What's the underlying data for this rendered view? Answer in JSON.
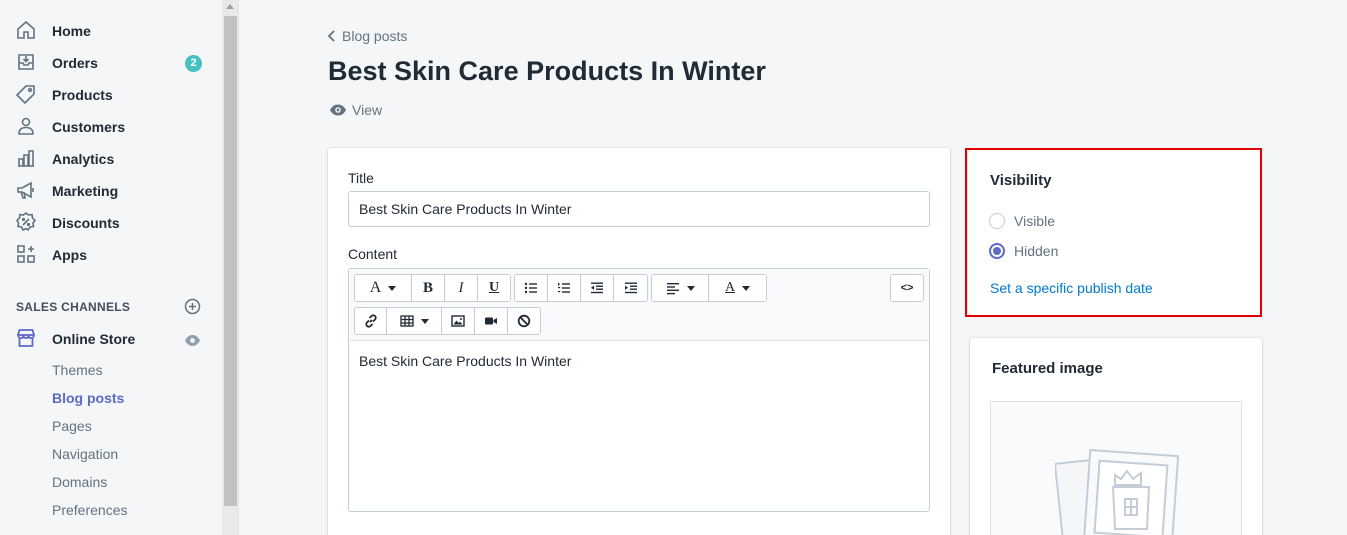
{
  "sidebar": {
    "items": [
      {
        "label": "Home",
        "icon": "home-icon"
      },
      {
        "label": "Orders",
        "icon": "orders-icon",
        "badge": "2"
      },
      {
        "label": "Products",
        "icon": "tag-icon"
      },
      {
        "label": "Customers",
        "icon": "person-icon"
      },
      {
        "label": "Analytics",
        "icon": "bar-chart-icon"
      },
      {
        "label": "Marketing",
        "icon": "megaphone-icon"
      },
      {
        "label": "Discounts",
        "icon": "discount-icon"
      },
      {
        "label": "Apps",
        "icon": "apps-icon"
      }
    ],
    "sales_channels_heading": "SALES CHANNELS",
    "online_store": {
      "label": "Online Store",
      "subitems": [
        "Themes",
        "Blog posts",
        "Pages",
        "Navigation",
        "Domains",
        "Preferences"
      ],
      "active": "Blog posts"
    }
  },
  "breadcrumb": "Blog posts",
  "page_title": "Best Skin Care Products In Winter",
  "view_label": "View",
  "main_card": {
    "title_label": "Title",
    "title_value": "Best Skin Care Products In Winter",
    "content_label": "Content",
    "toolbar": {
      "font_button": "A",
      "bold": "B",
      "italic": "I",
      "underline": "U",
      "text_color": "A",
      "html_toggle": "<>"
    },
    "content_value": "Best Skin Care Products In Winter"
  },
  "visibility_card": {
    "title": "Visibility",
    "options": [
      "Visible",
      "Hidden"
    ],
    "selected": "Hidden",
    "publish_link": "Set a specific publish date"
  },
  "featured_card": {
    "title": "Featured image"
  },
  "colors": {
    "accent": "#5c6ac4",
    "link": "#007ace",
    "badge": "#47c1bf",
    "highlight": "#e00000"
  }
}
